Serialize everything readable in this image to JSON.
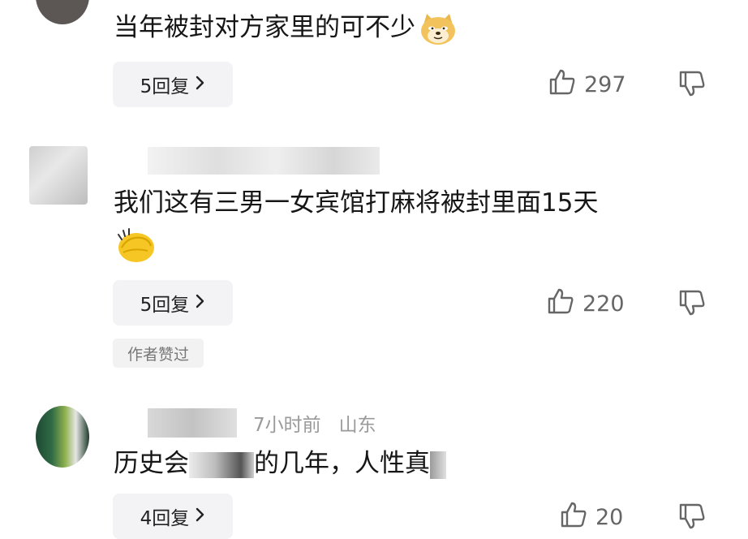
{
  "comments": [
    {
      "text": "当年被封对方家里的可不少",
      "emoji": "doge-emoji",
      "reply_label": "5回复",
      "likes": "297"
    },
    {
      "text": "我们这有三男一女宾馆打麻将被封里面15天",
      "emoji": "clap-emoji",
      "reply_label": "5回复",
      "likes": "220",
      "badge": "作者赞过"
    },
    {
      "text": "历史会",
      "text_tail": "的几年，人性真",
      "time": "7小时前",
      "location": "山东",
      "reply_label": "4回复",
      "likes": "20"
    }
  ],
  "icons": {
    "like": "thumbs-up-icon",
    "dislike": "thumbs-down-icon",
    "chevron": "chevron-right-icon"
  },
  "colors": {
    "button_bg": "#f3f3f5",
    "muted_text": "#9a9a9a",
    "count_text": "#666666"
  }
}
